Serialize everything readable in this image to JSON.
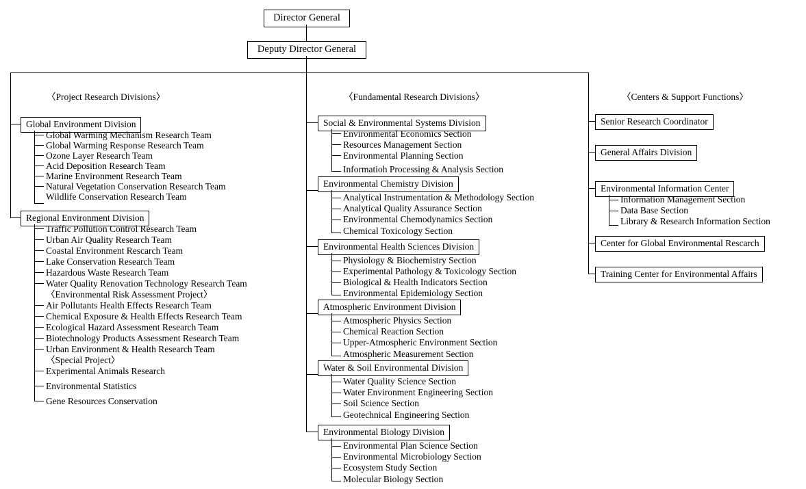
{
  "title_boxes": {
    "director_general": "Director General",
    "deputy_director_general": "Deputy Director General"
  },
  "columns": [
    {
      "caption": "〈Project Research Divisions〉",
      "groups": [
        {
          "box": "Global Environment Division",
          "items": [
            "Global Warming Mechanism Research Team",
            "Global Warming Response Research Team",
            "Ozone Layer Research Team",
            "Acid Deposition Research Team",
            "Marine Environment Research Team",
            "Natural Vegetation Conservation Research Team",
            "Wildlife Conservation Research Team"
          ]
        },
        {
          "box": "Regional Environment Division",
          "items": [
            "Traffic Pollution Control Research Team",
            "Urban Air Quality Research Team",
            "Coastal Environment Rescarch Team",
            "Lake Conservation Research Team",
            "Hazardous Waste Research Team",
            "Water Quality Renovation Technology Research Team",
            "〈Environmental Risk Assessment Project〉",
            "Air Pollutants Health Effects Research Team",
            "Chemical Exposure & Health Effects Research Team",
            "Ecological Hazard Assessment Research Team",
            "Biotechnology Products Assessment Research Team",
            "Urban Environment & Health Research Team",
            "〈Special Project〉",
            "Experimental Animals Research",
            "Environmental Statistics",
            "Gene Resources Conservation"
          ],
          "unmarked_items": [
            6,
            12
          ]
        }
      ]
    },
    {
      "caption": "〈Fundamental Research Divisions〉",
      "groups": [
        {
          "box": "Social & Environmental Systems Division",
          "items": [
            "Environmental Economics Section",
            "Resources Management Section",
            "Environmental Planning Section",
            "Informatioh Processing & Analysis Section"
          ]
        },
        {
          "box": "Environmental Chemistry Division",
          "items": [
            "Analytical Instrumentation & Methodology Section",
            "Analytical Quality Assurance Section",
            "Environmental Chemodynamics Section",
            "Chemical Toxicology Section"
          ]
        },
        {
          "box": "Environmental Health Sciences Division",
          "items": [
            "Physiology & Biochemistry Section",
            "Experimental Pathology & Toxicology Section",
            "Biological & Health Indicators Section",
            "Environmental Epidemiology Section"
          ]
        },
        {
          "box": "Atmospheric Environment Division",
          "items": [
            "Atmospheric Physics Section",
            "Chemical Reaction Section",
            "Upper-Atmospheric Environment Section",
            "Atmospheric Measurement Section"
          ]
        },
        {
          "box": "Water & Soil Environmental Division",
          "items": [
            "Water Quality Science Section",
            "Water Environment Engineering Section",
            "Soil Science Section",
            "Geotechnical Engineering Section"
          ]
        },
        {
          "box": "Environmental Biology Division",
          "items": [
            "Environmental Plan Science Section",
            "Environmental Microbiology Section",
            "Ecosystem Study Section",
            "Molecular Biology Section"
          ]
        }
      ]
    },
    {
      "caption": "〈Centers & Support Functions〉",
      "groups": [
        {
          "box": "Senior Research Coordinator",
          "items": []
        },
        {
          "box": "General Affairs Division",
          "items": []
        },
        {
          "box": "Environmental Information Center",
          "items": [
            "Information Management Section",
            "Data Base Section",
            "Library & Research Information Section"
          ]
        },
        {
          "box": "Center for Global Environmental Rescarch",
          "items": []
        },
        {
          "box": "Training Center for Environmental Affairs",
          "items": []
        }
      ]
    }
  ],
  "colors": {
    "ink": "#000000",
    "paper": "#ffffff"
  }
}
